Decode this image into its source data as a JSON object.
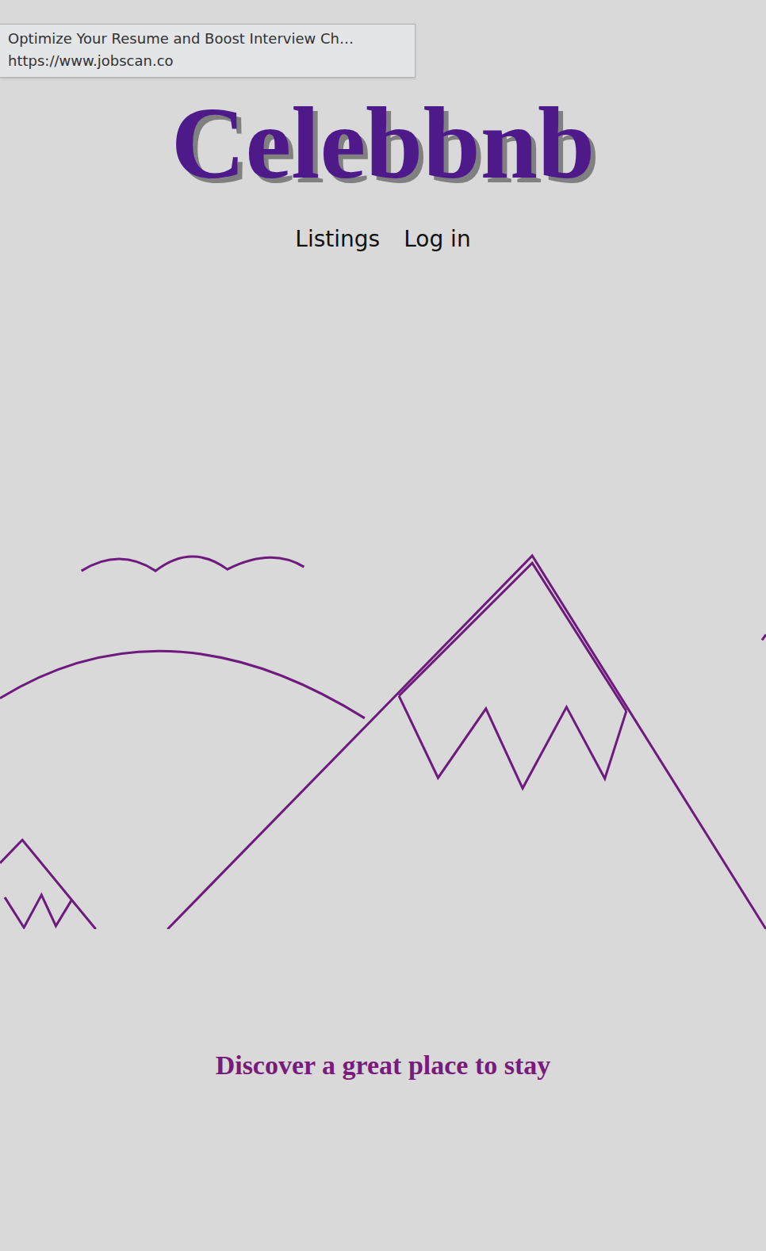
{
  "tooltip": {
    "title": "Optimize Your Resume and Boost Interview Ch…",
    "url": "https://www.jobscan.co"
  },
  "logo": "Celebbnb",
  "nav": [
    {
      "label": "Listings"
    },
    {
      "label": "Log in"
    }
  ],
  "tagline": "Discover a great place to stay"
}
